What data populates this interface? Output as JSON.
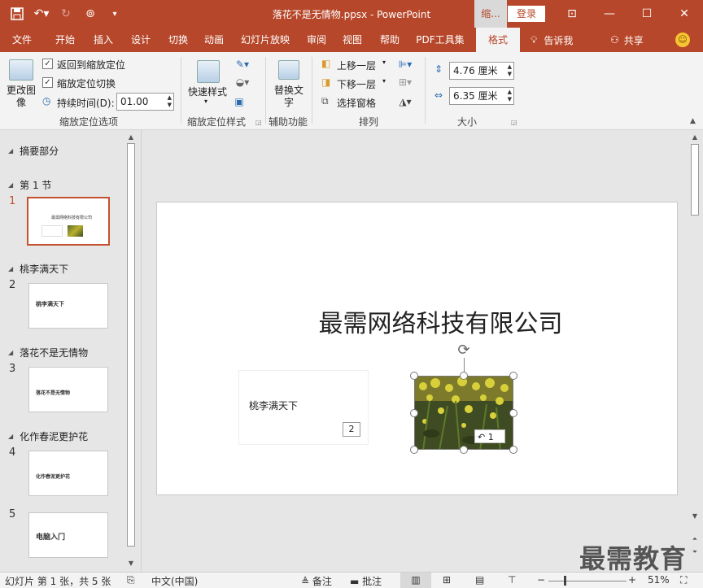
{
  "titlebar": {
    "title": "落花不是无情物.ppsx  -  PowerPoint",
    "context_tab": "缩...",
    "login": "登录"
  },
  "tabs": [
    {
      "label": "文件"
    },
    {
      "label": "开始"
    },
    {
      "label": "插入"
    },
    {
      "label": "设计"
    },
    {
      "label": "切换"
    },
    {
      "label": "动画"
    },
    {
      "label": "幻灯片放映"
    },
    {
      "label": "审阅"
    },
    {
      "label": "视图"
    },
    {
      "label": "帮助"
    },
    {
      "label": "PDF工具集"
    },
    {
      "label": "格式"
    }
  ],
  "tell_me": "告诉我",
  "share": "共享",
  "ribbon": {
    "change_image": "更改图像",
    "return_checkbox": "返回到缩放定位",
    "zoom_transition_checkbox": "缩放定位切换",
    "duration_label": "持续时间(D):",
    "duration_value": "01.00",
    "group1_label": "缩放定位选项",
    "quick_styles": "快速样式",
    "group2_label": "缩放定位样式",
    "alt_text": "替换文字",
    "group3_label": "辅助功能",
    "bring_forward": "上移一层",
    "send_backward": "下移一层",
    "selection_pane": "选择窗格",
    "group4_label": "排列",
    "height_value": "4.76 厘米",
    "width_value": "6.35 厘米",
    "group5_label": "大小"
  },
  "pane": {
    "sections": [
      {
        "label": "摘要部分"
      },
      {
        "label": "第 1 节"
      },
      {
        "label": "桃李满天下"
      },
      {
        "label": "落花不是无情物"
      },
      {
        "label": "化作春泥更护花"
      }
    ],
    "slides": [
      {
        "num": "1",
        "text": "最需网络科技有限公司"
      },
      {
        "num": "2",
        "text": "桃李满天下"
      },
      {
        "num": "3",
        "text": "落花不是无情物"
      },
      {
        "num": "4",
        "text": "化作春泥更护花"
      },
      {
        "num": "5",
        "text": "电脑入门"
      }
    ]
  },
  "slide": {
    "title": "最需网络科技有限公司",
    "zoom_label": "桃李满天下",
    "zoom_badge": "2",
    "pic_badge": "1"
  },
  "watermark": "最需教育",
  "status": {
    "slide_info": "幻灯片 第 1 张，共 5 张",
    "language": "中文(中国)",
    "notes": "备注",
    "comments": "批注",
    "zoom_level": "51%"
  },
  "colors": {
    "accent": "#b7472a",
    "selected_thumb": "#c5502f"
  }
}
